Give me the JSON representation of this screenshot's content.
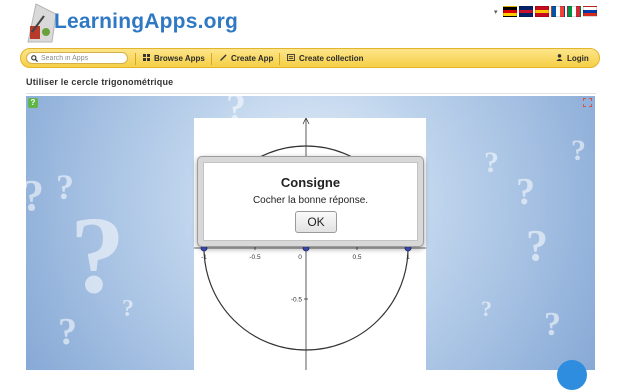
{
  "header": {
    "logo_text": "LearningApps.org",
    "language_toggle_glyph": "▾",
    "flags": [
      {
        "name": "german-flag",
        "colors": [
          "#000000",
          "#dd0000",
          "#ffce00"
        ]
      },
      {
        "name": "uk-flag",
        "colors": [
          "#012169",
          "#c8102e",
          "#012169"
        ]
      },
      {
        "name": "spanish-flag",
        "colors": [
          "#c60b1e",
          "#ffc400",
          "#c60b1e"
        ]
      },
      {
        "name": "french-flag",
        "colors": [
          "#0055a4",
          "#ffffff",
          "#ef4135"
        ]
      },
      {
        "name": "italian-flag",
        "colors": [
          "#009246",
          "#ffffff",
          "#ce2b37"
        ]
      },
      {
        "name": "russian-flag",
        "colors": [
          "#ffffff",
          "#0039a6",
          "#d52b1e"
        ]
      }
    ]
  },
  "toolbar": {
    "search_placeholder": "Search in Apps",
    "browse_label": "Browse Apps",
    "create_app_label": "Create App",
    "create_collection_label": "Create collection",
    "login_label": "Login",
    "accent_color": "#f6cf45"
  },
  "page": {
    "title": "Utiliser le cercle trigonométrique"
  },
  "app": {
    "help_glyph": "?",
    "graph": {
      "x_ticks": [
        "-1",
        "-0.5",
        "0",
        "0.5",
        "1"
      ],
      "y_ticks": [
        "-0.5"
      ],
      "points": [
        -1,
        0,
        1
      ]
    }
  },
  "modal": {
    "title": "Consigne",
    "text": "Cocher la bonne réponse.",
    "ok_label": "OK"
  }
}
